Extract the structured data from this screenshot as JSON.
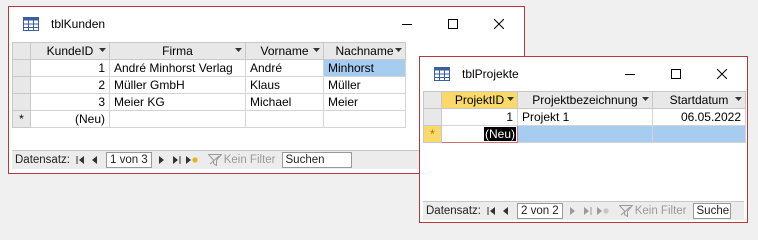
{
  "window1": {
    "title": "tblKunden",
    "columns": [
      "KundeID",
      "Firma",
      "Vorname",
      "Nachname"
    ],
    "rows": [
      [
        "1",
        "André Minhorst Verlag",
        "André",
        "Minhorst"
      ],
      [
        "2",
        "Müller GmbH",
        "Klaus",
        "Müller"
      ],
      [
        "3",
        "Meier KG",
        "Michael",
        "Meier"
      ]
    ],
    "new_row_selector": "*",
    "new_row_label": "(Neu)",
    "nav": {
      "label": "Datensatz:",
      "position": "1 von 3",
      "filter_label": "Kein Filter",
      "search_label": "Suchen"
    }
  },
  "window2": {
    "title": "tblProjekte",
    "columns": [
      "ProjektID",
      "Projektbezeichnung",
      "Startdatum"
    ],
    "rows": [
      [
        "1",
        "Projekt 1",
        "06.05.2022"
      ]
    ],
    "new_row_selector": "*",
    "new_row_label": "(Neu)",
    "nav": {
      "label": "Datensatz:",
      "position": "2 von 2",
      "filter_label": "Kein Filter",
      "search_label": "Suche"
    }
  },
  "colors": {
    "border": "#b23a3a",
    "selection": "#a6ccf0",
    "active_header": "#f8d96a",
    "new_row_marker": "#e8a800"
  },
  "icons": [
    "table-icon",
    "minimize-icon",
    "maximize-icon",
    "close-icon",
    "dropdown-arrow-icon",
    "first-record-icon",
    "previous-record-icon",
    "next-record-icon",
    "last-record-icon",
    "new-record-icon",
    "filter-icon"
  ]
}
